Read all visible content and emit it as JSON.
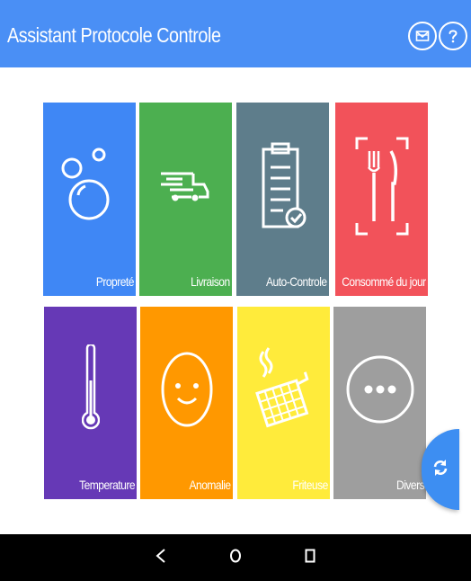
{
  "header": {
    "title": "Assistant Protocole Controle",
    "icons": [
      "mail-icon",
      "help-icon"
    ],
    "background": "#4a8ff5"
  },
  "tiles": [
    {
      "label": "Propreté",
      "icon": "bubbles-icon",
      "color": "#3f87f5"
    },
    {
      "label": "Livraison",
      "icon": "delivery-truck-icon",
      "color": "#4caf50"
    },
    {
      "label": "Auto-Controle",
      "icon": "checklist-clipboard-icon",
      "color": "#5e7d8b"
    },
    {
      "label": "Consommé du jour",
      "icon": "fork-knife-icon",
      "color": "#f2525a"
    },
    {
      "label": "Temperature",
      "icon": "thermometer-icon",
      "color": "#6639b6"
    },
    {
      "label": "Anomalie",
      "icon": "smiley-face-icon",
      "color": "#ff9800"
    },
    {
      "label": "Friteuse",
      "icon": "fryer-basket-icon",
      "color": "#ffeb3b"
    },
    {
      "label": "Divers",
      "icon": "more-dots-icon",
      "color": "#9e9e9e"
    }
  ],
  "fab": {
    "icon": "refresh-icon",
    "color": "#3d8ef2"
  },
  "navbar": {
    "icons": [
      "back-icon",
      "home-icon",
      "recents-icon"
    ]
  }
}
